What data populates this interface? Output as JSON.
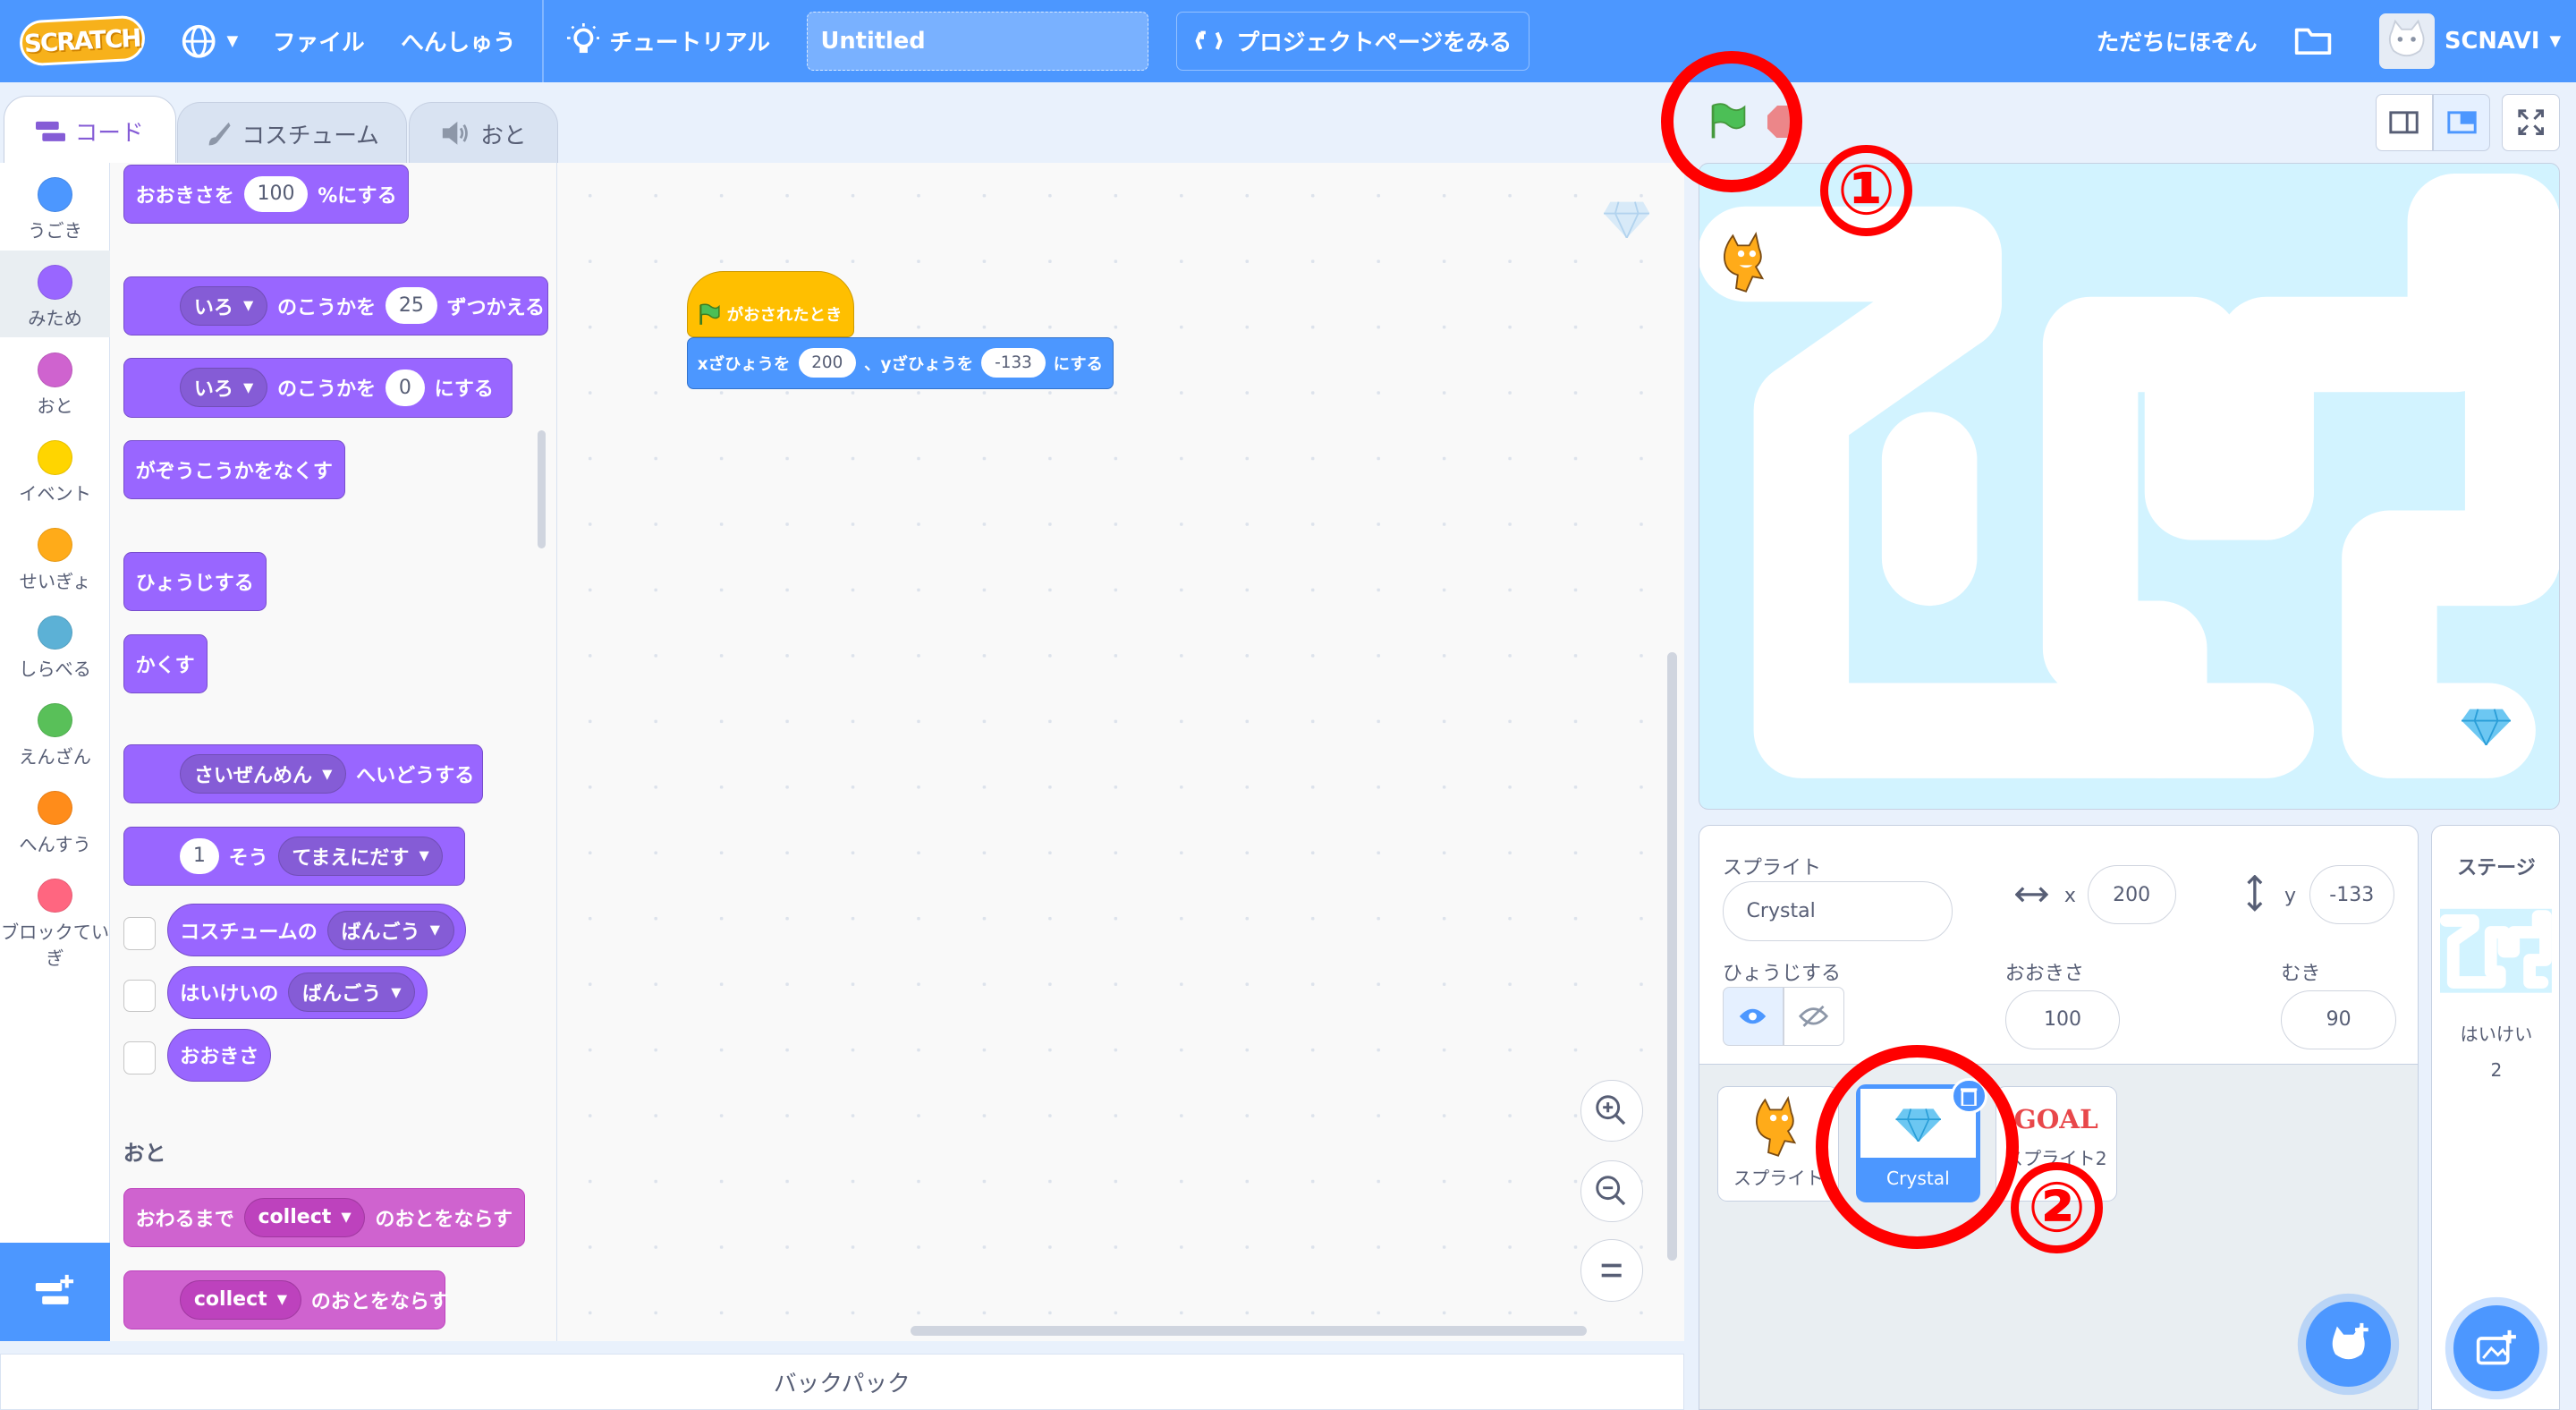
{
  "menubar": {
    "logo": "SCRATCH",
    "file": "ファイル",
    "edit": "へんしゅう",
    "tutorial": "チュートリアル",
    "project_title": "Untitled",
    "see_project": "プロジェクトページをみる",
    "share": "ただちにほぞん",
    "username": "SCNAVI"
  },
  "tabs": {
    "code": "コード",
    "costume": "コスチューム",
    "sound": "おと"
  },
  "categories": [
    "うごき",
    "みため",
    "おと",
    "イベント",
    "せいぎょ",
    "しらべる",
    "えんざん",
    "へんすう",
    "ブロックていぎ"
  ],
  "category_colors": [
    "#4c97ff",
    "#9966ff",
    "#cf63cf",
    "#ffd500",
    "#ffab19",
    "#5cb1d6",
    "#59c059",
    "#ff8c1a",
    "#ff6680"
  ],
  "palette": {
    "set_size": {
      "pre": "おおきさを",
      "val": "100",
      "post": "%にする"
    },
    "change_effect": {
      "dd": "いろ",
      "mid": "のこうかを",
      "val": "25",
      "post": "ずつかえる"
    },
    "set_effect": {
      "dd": "いろ",
      "mid": "のこうかを",
      "val": "0",
      "post": "にする"
    },
    "clear_effects": "がぞうこうかをなくす",
    "show": "ひょうじする",
    "hide": "かくす",
    "go_layer": {
      "dd": "さいぜんめん",
      "post": "へいどうする"
    },
    "go_layers": {
      "val": "1",
      "mid": "そう",
      "dd": "てまえにだす"
    },
    "costume_rep": {
      "pre": "コスチュームの",
      "dd": "ばんごう"
    },
    "backdrop_rep": {
      "pre": "はいけいの",
      "dd": "ばんごう"
    },
    "size_rep": "おおきさ",
    "sound_header": "おと",
    "play_until": {
      "pre": "おわるまで",
      "dd": "collect",
      "post": "のおとをならす"
    },
    "start_sound": {
      "dd": "collect",
      "post": "のおとをならす"
    }
  },
  "script": {
    "hat": "がおされたとき",
    "goto": {
      "x_label": "xざひょうを",
      "x": "200",
      "sep": "、yざひょうを",
      "y": "-133",
      "post": "にする"
    }
  },
  "backpack": "バックパック",
  "sprite_info": {
    "label": "スプライト",
    "name": "Crystal",
    "x_label": "x",
    "x": "200",
    "y_label": "y",
    "y": "-133",
    "show_label": "ひょうじする",
    "size_label": "おおきさ",
    "size": "100",
    "dir_label": "むき",
    "direction": "90"
  },
  "sprites": [
    {
      "name": "スプライト"
    },
    {
      "name": "Crystal",
      "selected": true
    },
    {
      "name": "スプライト2",
      "costume_text": "GOAL"
    }
  ],
  "stage_panel": {
    "title": "ステージ",
    "backdrop_label": "はいけい",
    "count": "2"
  },
  "annotations": {
    "one": "①",
    "two": "②"
  },
  "colors": {
    "accent": "#4c97ff",
    "looks": "#9966ff",
    "sound": "#cf63cf",
    "event": "#ffbf00",
    "motion": "#4c97ff",
    "annotation": "#ff0000"
  }
}
